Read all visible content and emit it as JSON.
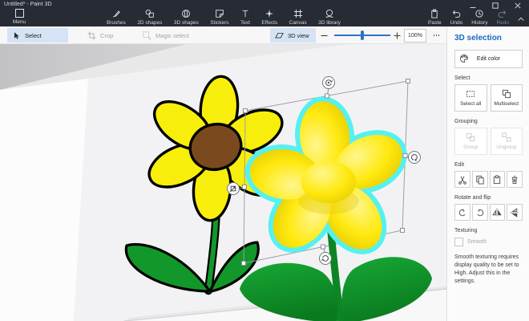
{
  "titlebar": {
    "title": "Untitled* - Paint 3D"
  },
  "menu": {
    "label": "Menu"
  },
  "toolbar": {
    "tools": [
      {
        "label": "Brushes"
      },
      {
        "label": "2D shapes"
      },
      {
        "label": "3D shapes"
      },
      {
        "label": "Stickers"
      },
      {
        "label": "Text"
      },
      {
        "label": "Effects"
      },
      {
        "label": "Canvas"
      },
      {
        "label": "3D library"
      }
    ],
    "right": [
      {
        "label": "Paste"
      },
      {
        "label": "Undo"
      },
      {
        "label": "History"
      },
      {
        "label": "Redo"
      }
    ]
  },
  "subtoolbar": {
    "select": "Select",
    "crop": "Crop",
    "magic_select": "Magic select",
    "view_3d": "3D view",
    "zoom_value": "100%"
  },
  "panel": {
    "title": "3D selection",
    "edit_color": "Edit color",
    "sections": {
      "select": {
        "label": "Select",
        "select_all": "Select all",
        "multiselect": "Multiselect"
      },
      "grouping": {
        "label": "Grouping",
        "group": "Group",
        "ungroup": "Ungroup"
      },
      "edit": {
        "label": "Edit"
      },
      "rotate": {
        "label": "Rotate and flip"
      },
      "texturing": {
        "label": "Texturing",
        "smooth": "Smooth",
        "note": "Smooth texturing requires display quality to be set to High. Adjust this in the settings."
      }
    }
  },
  "colors": {
    "titlebar_bg": "#262b34",
    "accent_blue": "#2d74c4",
    "panel_title_blue": "#1c6bbd",
    "active_button_bg": "#d5e3f4",
    "selection_cyan": "#55f1f1",
    "flower_yellow": "#f8ee0b",
    "flower_center_brown": "#7a4a1e",
    "leaf_green": "#12962b",
    "canvas_white": "#f2f2f4"
  }
}
